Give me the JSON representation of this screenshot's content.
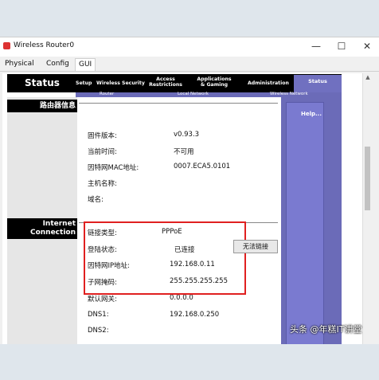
{
  "window": {
    "title": "Wireless Router0",
    "controls": [
      "—",
      "☐",
      "✕"
    ]
  },
  "tabs": [
    {
      "label": "Physical"
    },
    {
      "label": "Config"
    },
    {
      "label": "GUI"
    }
  ],
  "router_ui": {
    "header": {
      "status_title": "Status",
      "nav": {
        "setup": "Setup",
        "wireless_security": "Wireless Security",
        "access_restrictions_line1": "Access",
        "access_restrictions_line2": "Restrictions",
        "apps_gaming_line1": "Applications",
        "apps_gaming_line2": "& Gaming",
        "administration": "Administration",
        "status": "Status"
      },
      "subnav": {
        "router": "Router",
        "local_network": "Local Network",
        "wireless_network": "Wireless Network"
      }
    },
    "left_sections": {
      "router_info": "路由器信息",
      "internet_line1": "Internet",
      "internet_line2": "Connection"
    },
    "help": "Help...",
    "router_info_fields": [
      {
        "label": "固件版本:",
        "value": "v0.93.3"
      },
      {
        "label": "当前时间:",
        "value": "不可用"
      },
      {
        "label": "因特网MAC地址:",
        "value": "0007.ECA5.0101"
      },
      {
        "label": "主机名称:",
        "value": ""
      },
      {
        "label": "域名:",
        "value": ""
      }
    ],
    "internet_fields": [
      {
        "label": "链接类型:",
        "value": "PPPoE"
      },
      {
        "label": "登陆状态:",
        "value": "已连接"
      },
      {
        "label": "因特网IP地址:",
        "value": "192.168.0.11"
      },
      {
        "label": "子网掩码:",
        "value": "255.255.255.255"
      },
      {
        "label": "默认网关:",
        "value": "0.0.0.0"
      },
      {
        "label": "DNS1:",
        "value": "192.168.0.250"
      },
      {
        "label": "DNS2:",
        "value": ""
      }
    ],
    "disconnect_button": "无法链接"
  },
  "watermark": "头条 @年糕IT讲堂",
  "colors": {
    "header_black": "#000000",
    "status_purple": "#6b6bb8",
    "highlight_red": "#e02020"
  }
}
